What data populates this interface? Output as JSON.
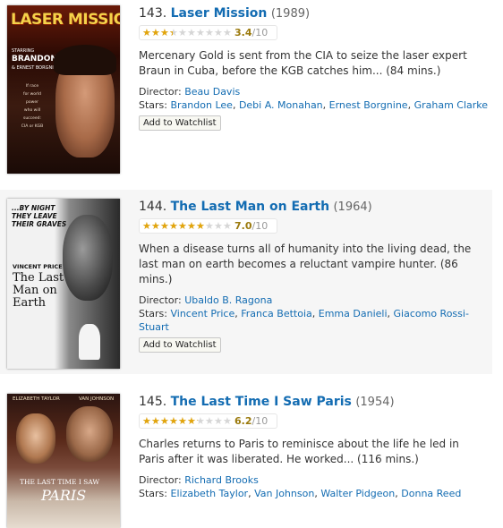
{
  "entries": [
    {
      "number": "143.",
      "title": "Laser Mission",
      "year": "(1989)",
      "rating": 3.4,
      "rating_text": "3.4",
      "rating_max": "/10",
      "description": "Mercenary Gold is sent from the CIA to seize the laser expert Braun in Cuba, before the KGB catches him... (84 mins.)",
      "director_label": "Director:",
      "director": "Beau Davis",
      "stars_label": "Stars:",
      "stars": [
        "Brandon Lee",
        "Debi A. Monahan",
        "Ernest Borgnine",
        "Graham Clarke"
      ],
      "watchlist_label": "Add to Watchlist",
      "poster": {
        "title": "LASER MISSION",
        "credits": [
          "STARRING",
          "BRANDON LEE",
          "& ERNEST BORGNINE"
        ],
        "tagline": [
          "If race",
          "for world",
          "power",
          "who will",
          "succeed:",
          "CIA or KGB"
        ]
      }
    },
    {
      "number": "144.",
      "title": "The Last Man on Earth",
      "year": "(1964)",
      "rating": 7.0,
      "rating_text": "7.0",
      "rating_max": "/10",
      "description": "When a disease turns all of humanity into the living dead, the last man on earth becomes a reluctant vampire hunter. (86 mins.)",
      "director_label": "Director:",
      "director": "Ubaldo B. Ragona",
      "stars_label": "Stars:",
      "stars": [
        "Vincent Price",
        "Franca Bettoia",
        "Emma Danieli",
        "Giacomo Rossi-Stuart"
      ],
      "watchlist_label": "Add to Watchlist",
      "poster": {
        "tagline": [
          "...BY NIGHT",
          "THEY LEAVE",
          "THEIR GRAVES"
        ],
        "actor": "VINCENT PRICE",
        "title": [
          "The Last",
          "Man on",
          "Earth"
        ]
      }
    },
    {
      "number": "145.",
      "title": "The Last Time I Saw Paris",
      "year": "(1954)",
      "rating": 6.2,
      "rating_text": "6.2",
      "rating_max": "/10",
      "description": "Charles returns to Paris to reminisce about the life he led in Paris after it was liberated. He worked... (116 mins.)",
      "director_label": "Director:",
      "director": "Richard Brooks",
      "stars_label": "Stars:",
      "stars": [
        "Elizabeth Taylor",
        "Van Johnson",
        "Walter Pidgeon",
        "Donna Reed"
      ],
      "watchlist_label": "Add to Watchlist",
      "poster": {
        "actors": [
          "ELIZABETH TAYLOR",
          "VAN JOHNSON"
        ],
        "title": [
          "THE LAST TIME I SAW",
          "PARIS"
        ]
      }
    }
  ],
  "colors": {
    "link": "#136cb2",
    "star_fill": "#e3a50b",
    "star_empty": "#d6d6d6",
    "row_shade": "#f6f6f6"
  }
}
